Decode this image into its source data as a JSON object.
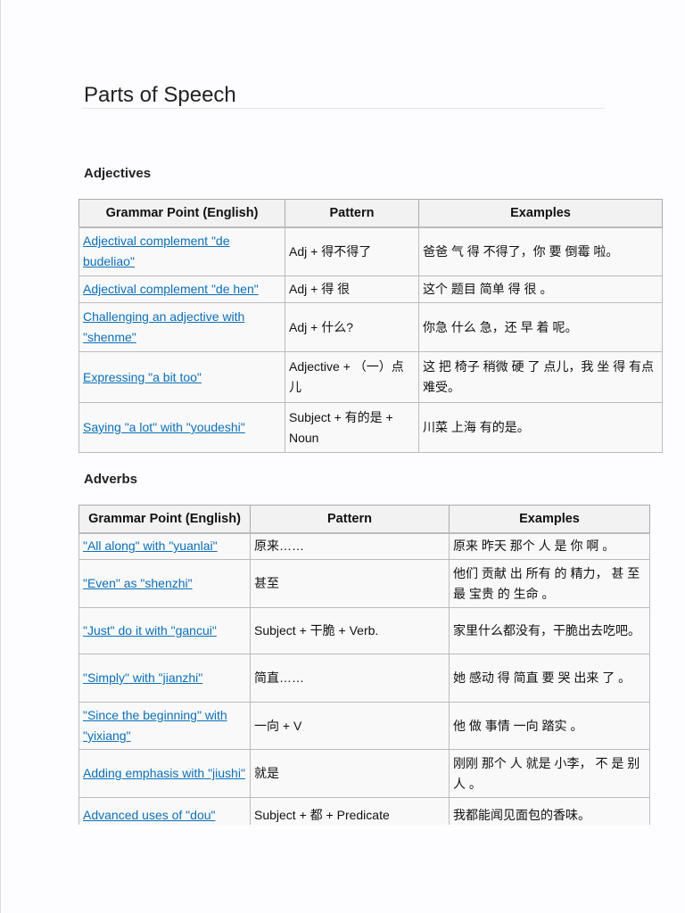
{
  "title": "Parts of Speech",
  "sections": [
    {
      "heading": "Adjectives",
      "headers": [
        "Grammar Point (English)",
        "Pattern",
        "Examples"
      ],
      "rows": [
        [
          "Adjectival complement \"de budeliao\"",
          "Adj + 得不得了",
          "爸爸 气 得 不得了，你 要 倒霉 啦。"
        ],
        [
          "Adjectival complement \"de hen\"",
          "Adj + 得 很",
          "这个 题目 简单 得 很 。"
        ],
        [
          "Challenging an adjective with \"shenme\"",
          "Adj + 什么?",
          "你急 什么 急，还 早 着 呢。"
        ],
        [
          "Expressing \"a bit too\"",
          "Adjective + （一）点儿",
          "这 把 椅子 稍微 硬 了 点儿，我 坐 得 有点 难受。"
        ],
        [
          "Saying \"a lot\" with \"youdeshi\"",
          "Subject + 有的是 + Noun",
          "川菜 上海 有的是。"
        ]
      ]
    },
    {
      "heading": "Adverbs",
      "headers": [
        "Grammar Point (English)",
        "Pattern",
        "Examples"
      ],
      "rows": [
        [
          "\"All along\" with \"yuanlai\"",
          "原来……",
          "原来 昨天 那个 人 是 你 啊 。"
        ],
        [
          "\"Even\" as \"shenzhi\"",
          "甚至",
          "他们 贡献 出 所有 的 精力， 甚 至 最 宝贵 的 生命 。"
        ],
        [
          "\"Just\" do it with \"gancui\"",
          "Subject + 干脆 + Verb.",
          "家里什么都没有，干脆出去吃吧。"
        ],
        [
          "\"Simply\" with \"jianzhi\"",
          "简直……",
          "她 感动 得 简直 要 哭 出来 了 。"
        ],
        [
          "\"Since the beginning\" with \"yixiang\"",
          "一向 + V",
          "他 做 事情 一向 踏实 。"
        ],
        [
          "Adding emphasis with \"jiushi\"",
          "就是",
          "刚刚 那个 人 就是 小李， 不 是 别人 。"
        ],
        [
          "Advanced uses of \"dou\"",
          "Subject + 都 + Predicate",
          "我都能闻见面包的香味。"
        ]
      ]
    }
  ]
}
